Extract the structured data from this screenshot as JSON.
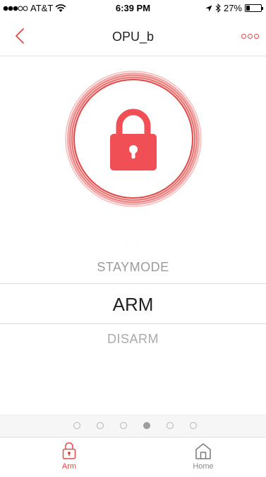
{
  "status_bar": {
    "carrier": "AT&T",
    "time": "6:39 PM",
    "battery_percent": "27%",
    "battery_level": 0.27
  },
  "nav": {
    "title": "OPU_b"
  },
  "picker": {
    "items": [
      "STAYMODE",
      "ARM",
      "DISARM"
    ],
    "selected": "ARM"
  },
  "pager": {
    "count": 6,
    "active_index": 3
  },
  "tabs": [
    {
      "label": "Arm",
      "icon": "lock-icon",
      "active": true
    },
    {
      "label": "Home",
      "icon": "home-icon",
      "active": false
    }
  ],
  "colors": {
    "accent": "#e24a4a",
    "lock_fill": "#ef4f55"
  }
}
